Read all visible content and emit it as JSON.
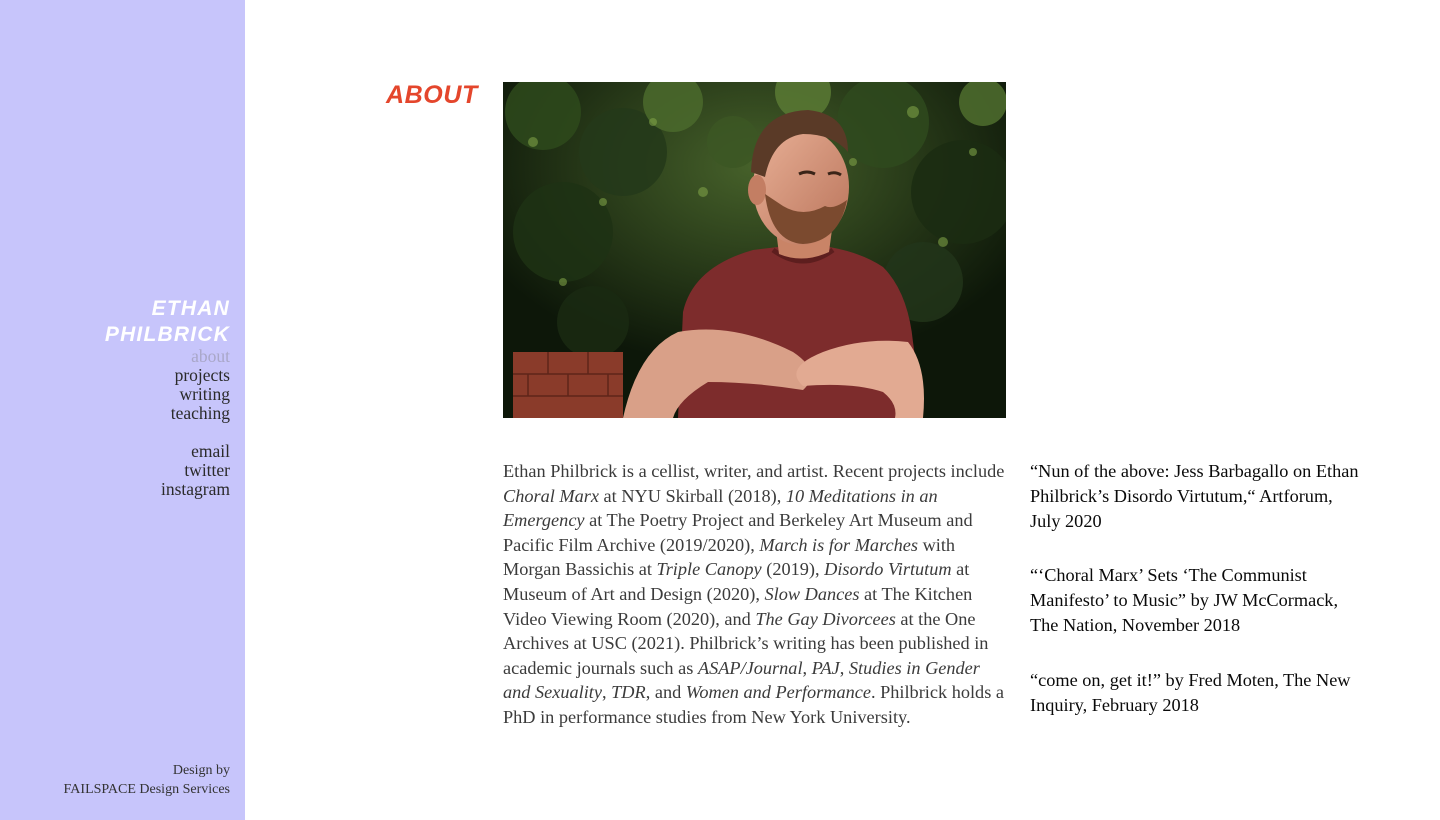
{
  "sidebar": {
    "name_line1": "ETHAN",
    "name_line2": "PHILBRICK",
    "nav": [
      {
        "label": "about",
        "active": true
      },
      {
        "label": "projects"
      },
      {
        "label": "writing"
      },
      {
        "label": "teaching"
      }
    ],
    "social": [
      {
        "label": "email"
      },
      {
        "label": "twitter"
      },
      {
        "label": "instagram"
      }
    ],
    "credit_line1": "Design by",
    "credit_line2": "FAILSPACE Design Services",
    "background_color": "#c7c5fb"
  },
  "main": {
    "heading": "ABOUT",
    "heading_color": "#e4462c",
    "bio": [
      {
        "text": "Ethan Philbrick is a cellist, writer, and artist. Recent projects include "
      },
      {
        "text": "Choral Marx",
        "italic": true
      },
      {
        "text": " at NYU Skirball (2018), "
      },
      {
        "text": "10 Meditations in an Emergency",
        "italic": true
      },
      {
        "text": " at The Poetry Project and Berkeley Art Museum and Pacific Film Archive (2019/2020), "
      },
      {
        "text": "March is for Marches",
        "italic": true
      },
      {
        "text": " with Morgan Bassichis at "
      },
      {
        "text": "Triple Canopy",
        "italic": true
      },
      {
        "text": " (2019), "
      },
      {
        "text": "Disordo Virtutum",
        "italic": true
      },
      {
        "text": " at Museum of Art and Design (2020), "
      },
      {
        "text": "Slow Dances",
        "italic": true
      },
      {
        "text": " at The Kitchen Video Viewing Room (2020), and "
      },
      {
        "text": "The Gay Divorcees",
        "italic": true
      },
      {
        "text": " at the One Archives at USC (2021). Philbrick’s writing has been published in academic journals such as "
      },
      {
        "text": "ASAP/Journal",
        "italic": true
      },
      {
        "text": ", "
      },
      {
        "text": "PAJ",
        "italic": true
      },
      {
        "text": ", "
      },
      {
        "text": "Studies in Gender and Sexuality",
        "italic": true
      },
      {
        "text": ", "
      },
      {
        "text": "TDR",
        "italic": true
      },
      {
        "text": ", and "
      },
      {
        "text": "Women and Performance",
        "italic": true
      },
      {
        "text": ". Philbrick holds a PhD in performance studies from New York University."
      }
    ],
    "press": [
      "“Nun of the above: Jess Barbagallo on Ethan Philbrick’s Disordo Virtutum,“ Artforum, July 2020",
      "“‘Choral Marx’ Sets ‘The Communist Manifesto’ to Music” by JW McCormack, The Nation, November 2018",
      "“come on, get it!” by Fred Moten, The New Inquiry, February 2018"
    ]
  }
}
